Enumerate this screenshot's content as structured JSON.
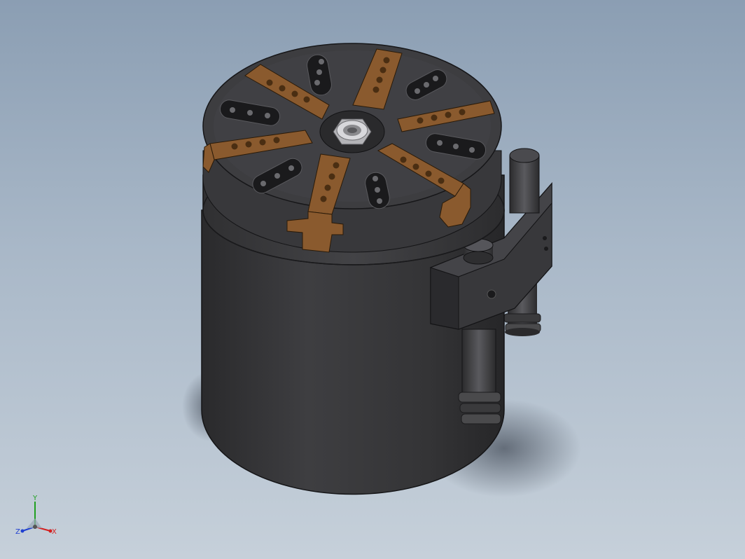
{
  "viewport": {
    "background_top": "#8b9eb3",
    "background_bottom": "#c6d0da"
  },
  "model": {
    "body_color": "#3a3a3c",
    "jaw_color": "#8a5a2e",
    "nut_color": "#c8c8c8"
  },
  "triad": {
    "x_label": "X",
    "y_label": "Y",
    "z_label": "Z",
    "x_color": "#d42020",
    "y_color": "#20a020",
    "z_color": "#2040d0"
  }
}
